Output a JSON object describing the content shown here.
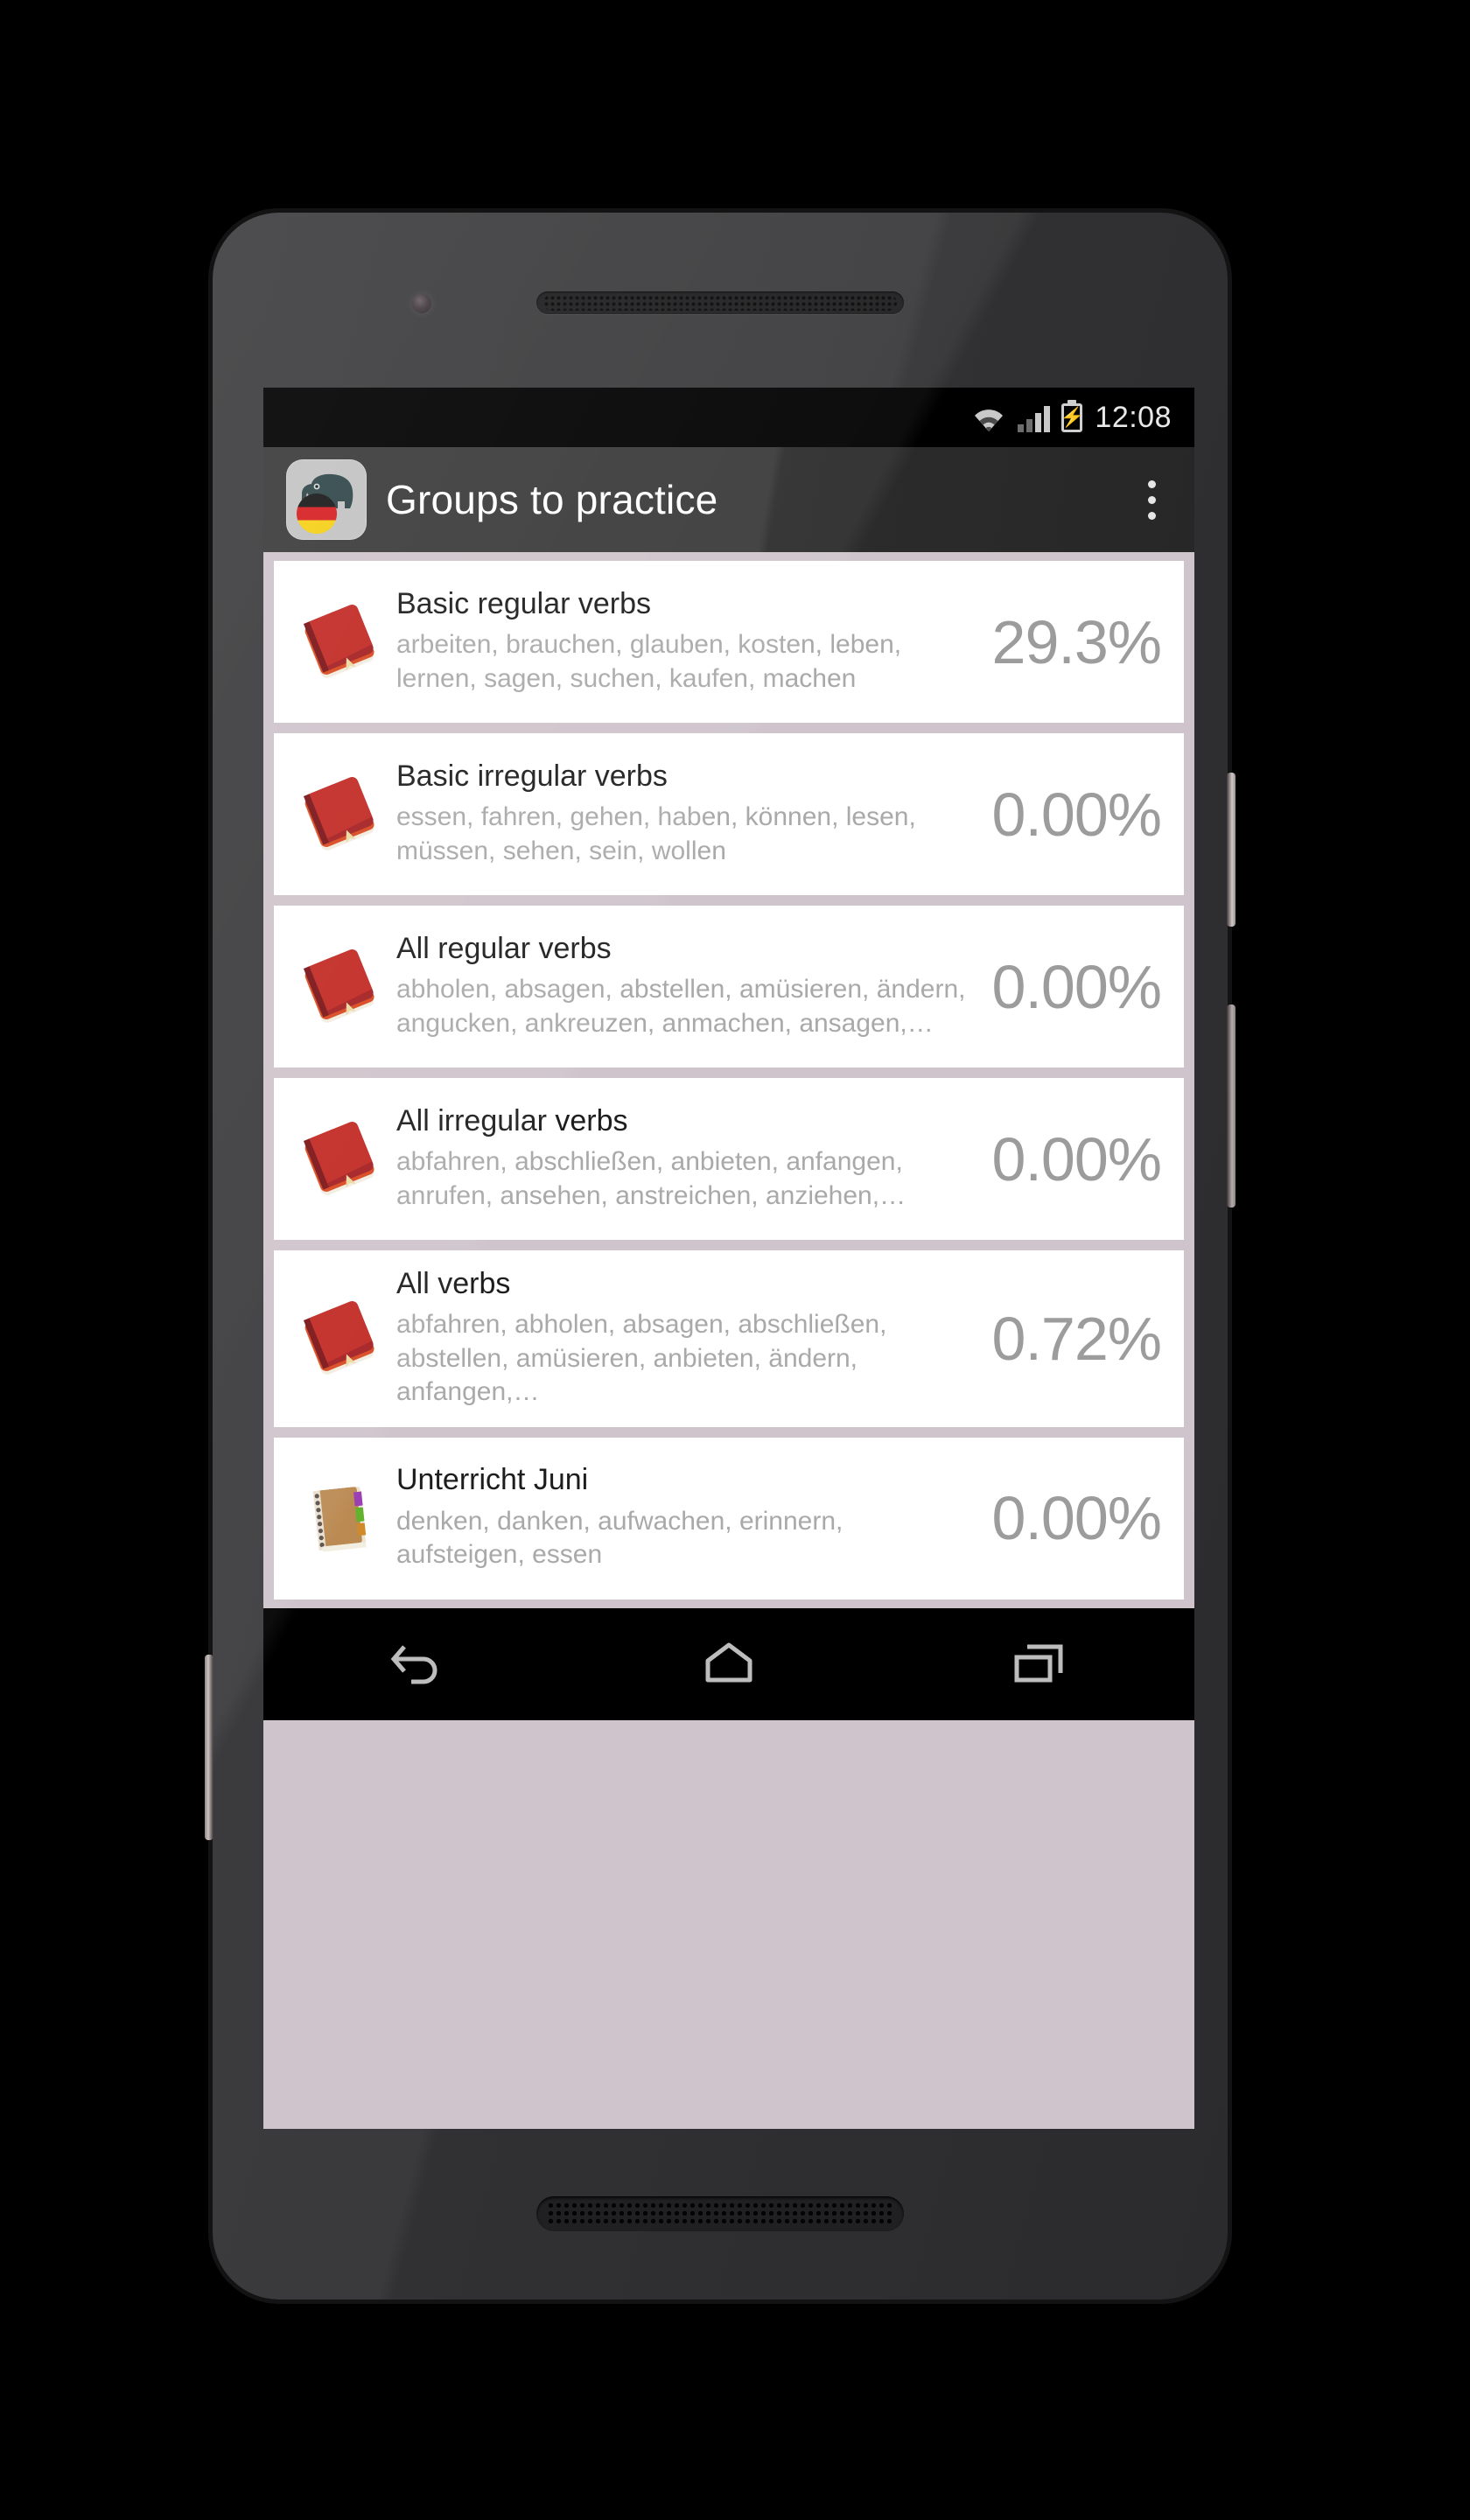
{
  "device": {
    "kind": "android-phone",
    "body_color": "#3a3a3c"
  },
  "status_bar": {
    "time": "12:08",
    "icons": [
      "wifi-icon",
      "signal-bars-icon",
      "battery-charging-icon"
    ],
    "battery_glyph": "⚡"
  },
  "action_bar": {
    "title": "Groups to practice",
    "app_icon": "elephant-app-icon",
    "flag": "german-flag-icon",
    "overflow": "overflow-menu-icon",
    "background": "#3a3a3a"
  },
  "list": {
    "background": "#cfc4cb",
    "items": [
      {
        "icon": "red-book-icon",
        "title": "Basic regular verbs",
        "words": "arbeiten, brauchen, glauben, kosten, leben, lernen, sagen, suchen, kaufen, machen",
        "percent": "29.3%"
      },
      {
        "icon": "red-book-icon",
        "title": "Basic irregular verbs",
        "words": "essen, fahren, gehen, haben, können, lesen, müssen, sehen, sein, wollen",
        "percent": "0.00%"
      },
      {
        "icon": "red-book-icon",
        "title": "All regular verbs",
        "words": "abholen, absagen, abstellen, amüsieren, ändern, angucken, ankreuzen, anmachen, ansagen,…",
        "percent": "0.00%"
      },
      {
        "icon": "red-book-icon",
        "title": "All irregular verbs",
        "words": "abfahren, abschließen, anbieten, anfangen, anrufen, ansehen, anstreichen, anziehen,…",
        "percent": "0.00%"
      },
      {
        "icon": "red-book-icon",
        "title": "All verbs",
        "words": "abfahren, abholen, absagen, abschließen, abstellen, amüsieren, anbieten, ändern, anfangen,…",
        "percent": "0.72%"
      },
      {
        "icon": "notebook-icon",
        "title": "Unterricht Juni",
        "words": "denken, danken, aufwachen, erinnern, aufsteigen, essen",
        "percent": "0.00%"
      }
    ]
  },
  "nav_bar": {
    "buttons": [
      "back-nav-icon",
      "home-nav-icon",
      "recents-nav-icon"
    ]
  }
}
